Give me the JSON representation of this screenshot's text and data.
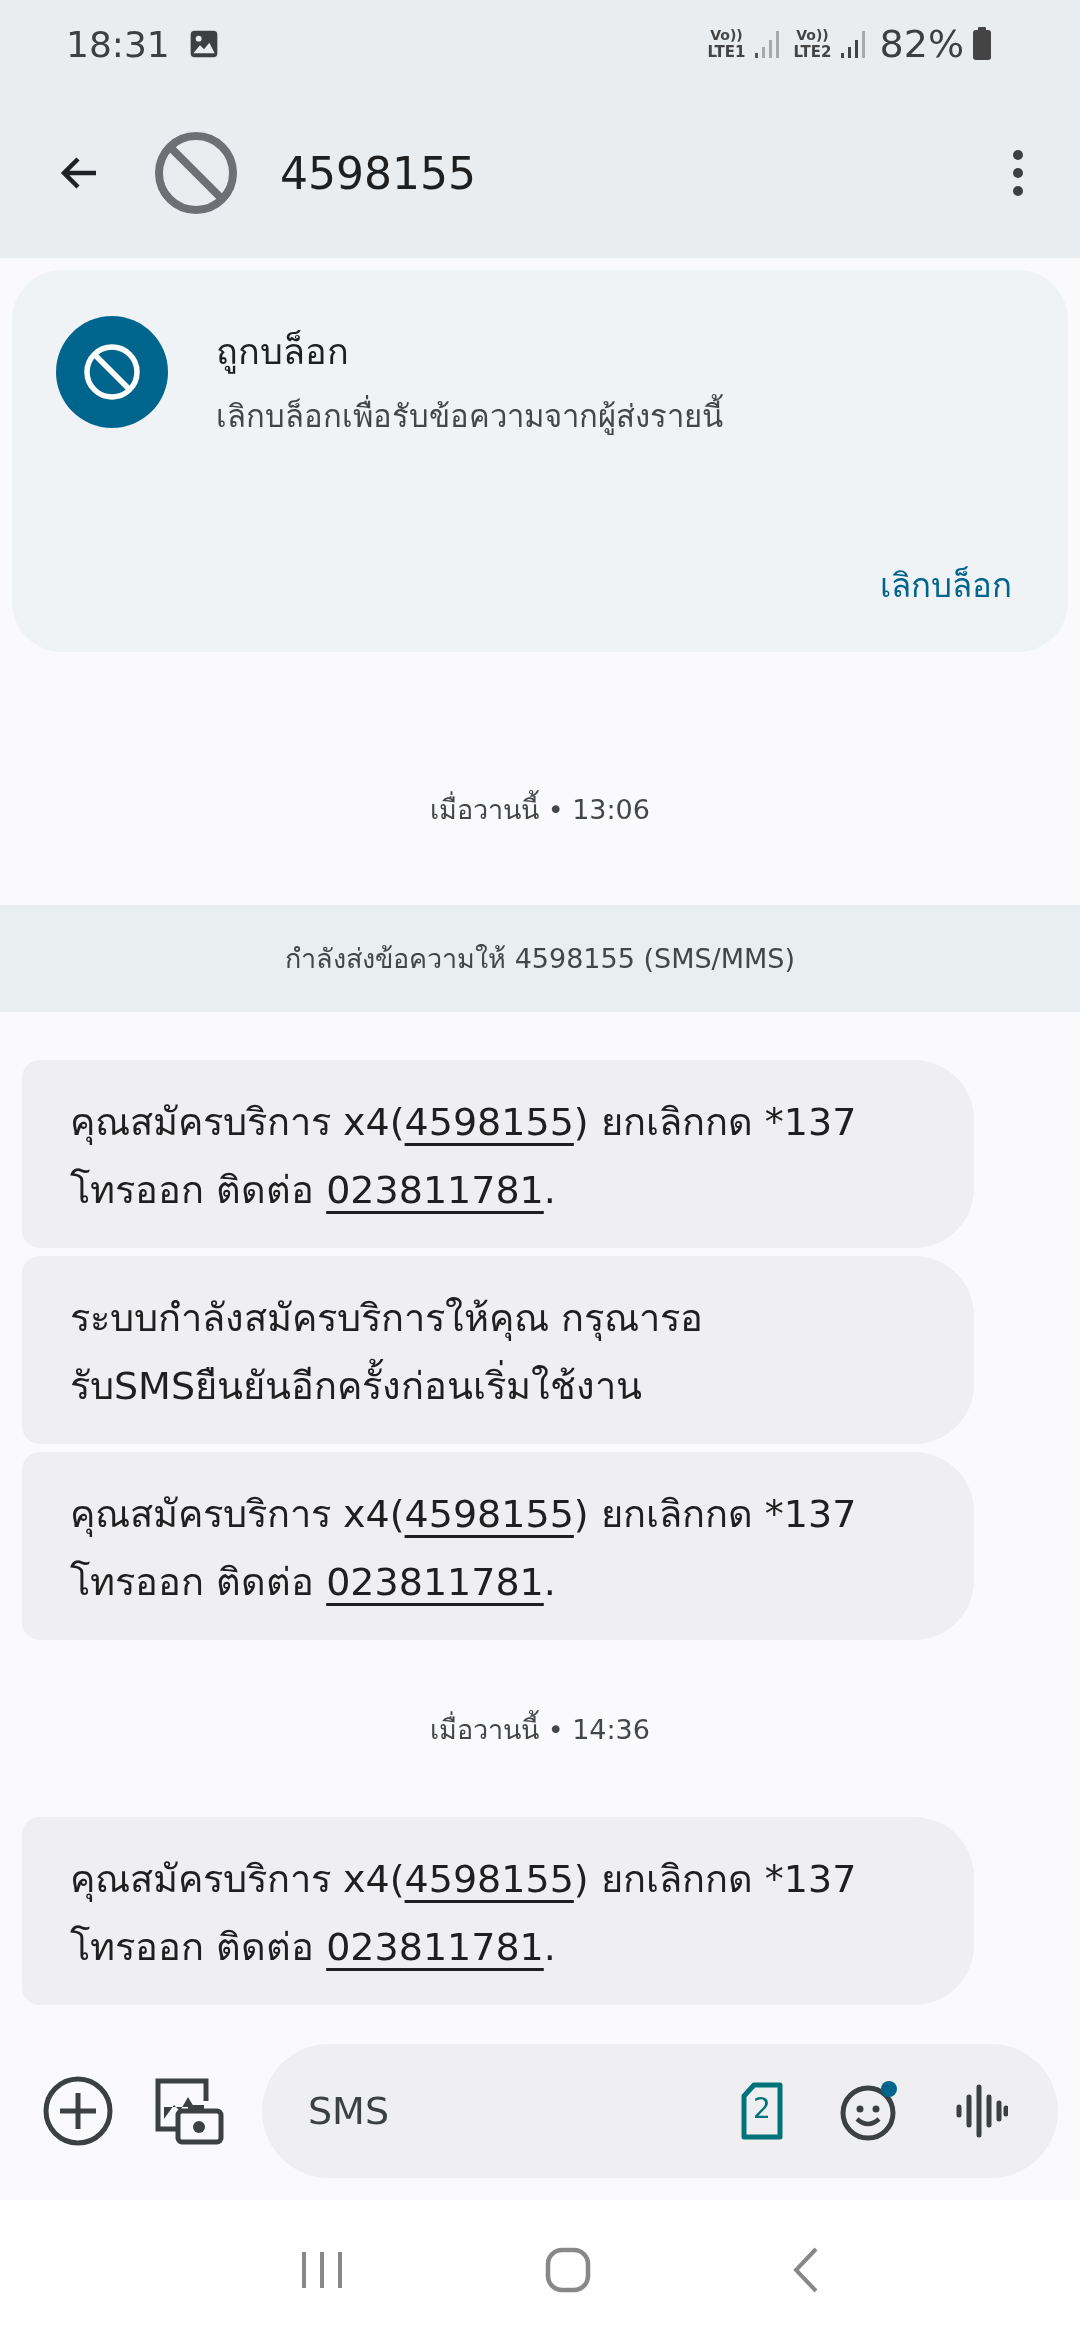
{
  "status_bar": {
    "time": "18:31",
    "volte1": "Vo))",
    "sim1": "LTE1",
    "volte2": "Vo))",
    "sim2": "LTE2",
    "battery": "82%"
  },
  "header": {
    "title": "4598155"
  },
  "blocked_card": {
    "title": "ถูกบล็อก",
    "subtitle": "เลิกบล็อกเพื่อรับข้อความจากผู้ส่งรายนี้",
    "action": "เลิกบล็อก"
  },
  "conversation": [
    {
      "kind": "date",
      "text": "เมื่อวานนี้ • 13:06"
    },
    {
      "kind": "banner",
      "text": "กำลังส่งข้อความให้ 4598155 (SMS/MMS)"
    },
    {
      "kind": "message",
      "parts": [
        {
          "text": "คุณสมัครบริการ x4(",
          "link": false
        },
        {
          "text": "4598155",
          "link": true
        },
        {
          "text": ") ยกเลิกกด *137 โทรออก ติดต่อ ",
          "link": false
        },
        {
          "text": "023811781",
          "link": true
        },
        {
          "text": ".",
          "link": false
        }
      ]
    },
    {
      "kind": "message",
      "parts": [
        {
          "text": "ระบบกำลังสมัครบริการให้คุณ กรุณารอ รับSMSยืนยันอีกครั้งก่อนเริ่มใช้งาน",
          "link": false
        }
      ]
    },
    {
      "kind": "message",
      "parts": [
        {
          "text": "คุณสมัครบริการ x4(",
          "link": false
        },
        {
          "text": "4598155",
          "link": true
        },
        {
          "text": ") ยกเลิกกด *137 โทรออก ติดต่อ ",
          "link": false
        },
        {
          "text": "023811781",
          "link": true
        },
        {
          "text": ".",
          "link": false
        }
      ]
    },
    {
      "kind": "date",
      "text": "เมื่อวานนี้ • 14:36"
    },
    {
      "kind": "message",
      "parts": [
        {
          "text": "คุณสมัครบริการ x4(",
          "link": false
        },
        {
          "text": "4598155",
          "link": true
        },
        {
          "text": ") ยกเลิกกด *137 โทรออก ติดต่อ ",
          "link": false
        },
        {
          "text": "023811781",
          "link": true
        },
        {
          "text": ".",
          "link": false
        }
      ]
    }
  ],
  "compose": {
    "placeholder": "SMS",
    "sim_number": "2"
  }
}
